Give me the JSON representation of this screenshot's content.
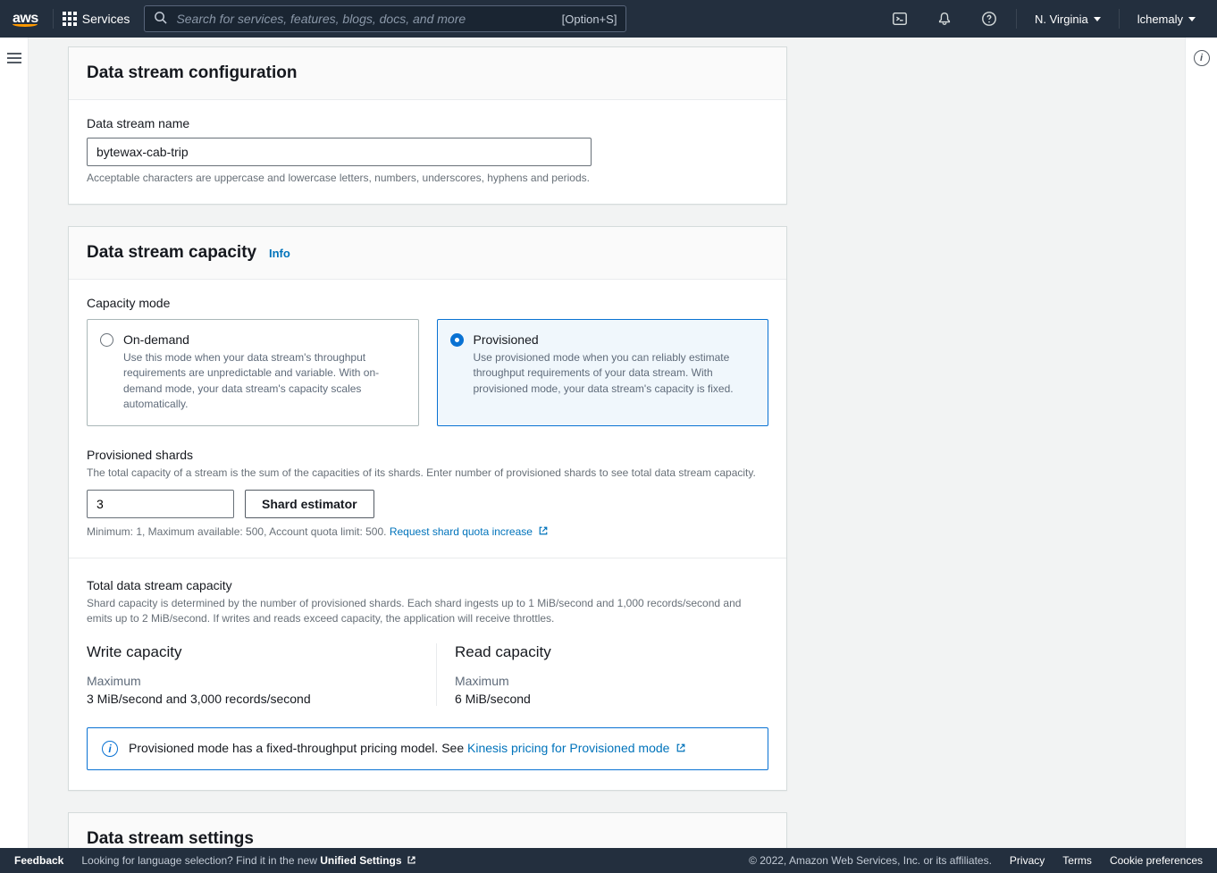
{
  "topnav": {
    "logo_text": "aws",
    "services_label": "Services",
    "search_placeholder": "Search for services, features, blogs, docs, and more",
    "search_shortcut": "[Option+S]",
    "region_label": "N. Virginia",
    "user_label": "lchemaly"
  },
  "config": {
    "header": "Data stream configuration",
    "name_label": "Data stream name",
    "name_value": "bytewax-cab-trip",
    "name_hint": "Acceptable characters are uppercase and lowercase letters, numbers, underscores, hyphens and periods."
  },
  "capacity": {
    "header": "Data stream capacity",
    "info_label": "Info",
    "mode_label": "Capacity mode",
    "options": {
      "ondemand": {
        "title": "On-demand",
        "desc": "Use this mode when your data stream's throughput requirements are unpredictable and variable. With on-demand mode, your data stream's capacity scales automatically."
      },
      "provisioned": {
        "title": "Provisioned",
        "desc": "Use provisioned mode when you can reliably estimate throughput requirements of your data stream. With provisioned mode, your data stream's capacity is fixed."
      }
    },
    "shards": {
      "label": "Provisioned shards",
      "hint": "The total capacity of a stream is the sum of the capacities of its shards. Enter number of provisioned shards to see total data stream capacity.",
      "value": "3",
      "estimator_label": "Shard estimator",
      "limits_prefix": "Minimum: 1, Maximum available: 500, Account quota limit: 500. ",
      "quota_link": "Request shard quota increase"
    },
    "total": {
      "label": "Total data stream capacity",
      "hint": "Shard capacity is determined by the number of provisioned shards. Each shard ingests up to 1 MiB/second and 1,000 records/second and emits up to 2 MiB/second. If writes and reads exceed capacity, the application will receive throttles."
    },
    "write": {
      "heading": "Write capacity",
      "sub": "Maximum",
      "value": "3 MiB/second and 3,000 records/second"
    },
    "read": {
      "heading": "Read capacity",
      "sub": "Maximum",
      "value": "6 MiB/second"
    },
    "alert": {
      "prefix": "Provisioned mode has a fixed-throughput pricing model. See ",
      "link": "Kinesis pricing for Provisioned mode"
    }
  },
  "settings": {
    "header": "Data stream settings"
  },
  "footer": {
    "feedback": "Feedback",
    "lang_prefix": "Looking for language selection? Find it in the new ",
    "lang_link": "Unified Settings",
    "copyright": "© 2022, Amazon Web Services, Inc. or its affiliates.",
    "privacy": "Privacy",
    "terms": "Terms",
    "cookie": "Cookie preferences"
  }
}
